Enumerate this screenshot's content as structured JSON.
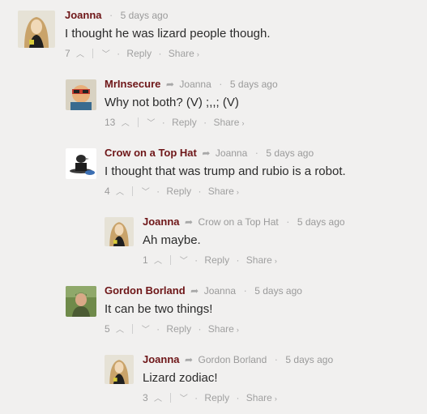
{
  "comments": [
    {
      "author": "Joanna",
      "reply_to": "",
      "time": "5 days ago",
      "text": "I thought he was lizard people though.",
      "upvotes": "7",
      "reply_label": "Reply",
      "share_label": "Share",
      "avatar": "joanna-avatar"
    },
    {
      "author": "MrInsecure",
      "reply_to": "Joanna",
      "time": "5 days ago",
      "text": "Why not both? (V) ;,,; (V)",
      "upvotes": "13",
      "reply_label": "Reply",
      "share_label": "Share",
      "avatar": "mrinsecure-avatar"
    },
    {
      "author": "Crow on a Top Hat",
      "reply_to": "Joanna",
      "time": "5 days ago",
      "text": "I thought that was trump and rubio is a robot.",
      "upvotes": "4",
      "reply_label": "Reply",
      "share_label": "Share",
      "avatar": "crow-avatar"
    },
    {
      "author": "Joanna",
      "reply_to": "Crow on a Top Hat",
      "time": "5 days ago",
      "text": "Ah maybe.",
      "upvotes": "1",
      "reply_label": "Reply",
      "share_label": "Share",
      "avatar": "joanna-avatar"
    },
    {
      "author": "Gordon Borland",
      "reply_to": "Joanna",
      "time": "5 days ago",
      "text": "It can be two things!",
      "upvotes": "5",
      "reply_label": "Reply",
      "share_label": "Share",
      "avatar": "gordon-avatar"
    },
    {
      "author": "Joanna",
      "reply_to": "Gordon Borland",
      "time": "5 days ago",
      "text": "Lizard zodiac!",
      "upvotes": "3",
      "reply_label": "Reply",
      "share_label": "Share",
      "avatar": "joanna-avatar"
    }
  ],
  "colors": {
    "author": "#6e1618",
    "background": "#f1f0ef",
    "text": "#2b2b2b",
    "meta": "#9a9a9a"
  }
}
